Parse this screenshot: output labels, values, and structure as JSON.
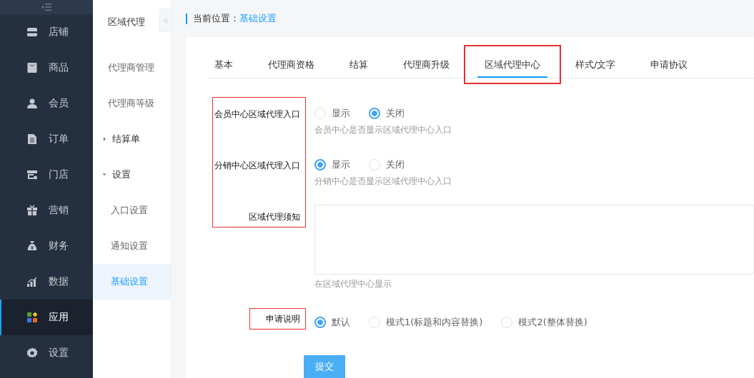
{
  "main_nav": {
    "items": [
      {
        "label": "店铺",
        "selected": false
      },
      {
        "label": "商品",
        "selected": false
      },
      {
        "label": "会员",
        "selected": false
      },
      {
        "label": "订单",
        "selected": false
      },
      {
        "label": "门店",
        "selected": false
      },
      {
        "label": "营销",
        "selected": false
      },
      {
        "label": "财务",
        "selected": false
      },
      {
        "label": "数据",
        "selected": false
      },
      {
        "label": "应用",
        "selected": true
      },
      {
        "label": "设置",
        "selected": false
      }
    ]
  },
  "sub_nav": {
    "title": "区域代理",
    "items": [
      {
        "label": "代理商管理",
        "selected": false
      },
      {
        "label": "代理商等级",
        "selected": false
      },
      {
        "label": "结算单",
        "selected": false,
        "expanded": false
      },
      {
        "label": "设置",
        "selected": false,
        "expanded": true,
        "children": [
          {
            "label": "入口设置",
            "selected": false
          },
          {
            "label": "通知设置",
            "selected": false
          },
          {
            "label": "基础设置",
            "selected": true
          }
        ]
      }
    ]
  },
  "breadcrumb": {
    "label": "当前位置：",
    "current": "基础设置"
  },
  "tabs": [
    {
      "label": "基本",
      "selected": false,
      "highlighted": false
    },
    {
      "label": "代理商资格",
      "selected": false,
      "highlighted": false
    },
    {
      "label": "结算",
      "selected": false,
      "highlighted": false
    },
    {
      "label": "代理商升级",
      "selected": false,
      "highlighted": false
    },
    {
      "label": "区域代理中心",
      "selected": true,
      "highlighted": true
    },
    {
      "label": "样式/文字",
      "selected": false,
      "highlighted": false
    },
    {
      "label": "申请协议",
      "selected": false,
      "highlighted": false
    }
  ],
  "form": {
    "groups": [
      {
        "highlighted": true,
        "fields": [
          {
            "kind": "radio",
            "label": "会员中心区域代理入口",
            "options": [
              {
                "label": "显示",
                "selected": false
              },
              {
                "label": "关闭",
                "selected": true
              }
            ],
            "help": "会员中心是否显示区域代理中心入口"
          },
          {
            "kind": "radio",
            "label": "分销中心区域代理入口",
            "options": [
              {
                "label": "显示",
                "selected": true
              },
              {
                "label": "关闭",
                "selected": false
              }
            ],
            "help": "分销中心是否显示区域代理中心入口"
          },
          {
            "kind": "textarea",
            "label": "区域代理须知",
            "help": "在区域代理中心显示"
          }
        ]
      },
      {
        "highlighted": true,
        "fields": [
          {
            "kind": "radio",
            "label": "申请说明",
            "options": [
              {
                "label": "默认",
                "selected": true
              },
              {
                "label": "模式1(标题和内容替换)",
                "selected": false
              },
              {
                "label": "模式2(整体替换)",
                "selected": false
              }
            ]
          }
        ]
      }
    ],
    "submit": "提交"
  }
}
